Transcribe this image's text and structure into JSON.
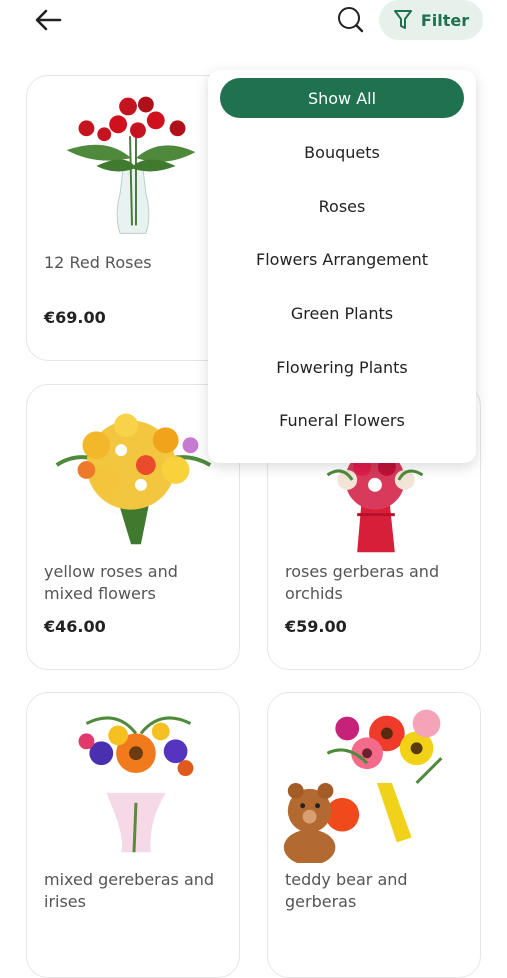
{
  "header": {
    "filter_label": "Filter",
    "icons": {
      "back": "arrow-left-icon",
      "search": "search-icon",
      "filter": "funnel-icon"
    }
  },
  "colors": {
    "accent": "#1f7150",
    "accent_soft": "#e6f1ec"
  },
  "filter_menu": {
    "items": [
      {
        "label": "Show All",
        "active": true
      },
      {
        "label": "Bouquets"
      },
      {
        "label": "Roses"
      },
      {
        "label": "Flowers Arrangement"
      },
      {
        "label": "Green Plants"
      },
      {
        "label": "Flowering Plants"
      },
      {
        "label": "Funeral Flowers"
      }
    ]
  },
  "products": [
    {
      "name": "12 Red Roses",
      "price": "€69.00"
    },
    {
      "name": "yellow roses and mixed flowers",
      "price": "€46.00"
    },
    {
      "name": "roses gerberas and orchids",
      "price": "€59.00"
    },
    {
      "name": "mixed gereberas and irises",
      "price": ""
    },
    {
      "name": "teddy bear and gerberas",
      "price": ""
    }
  ]
}
